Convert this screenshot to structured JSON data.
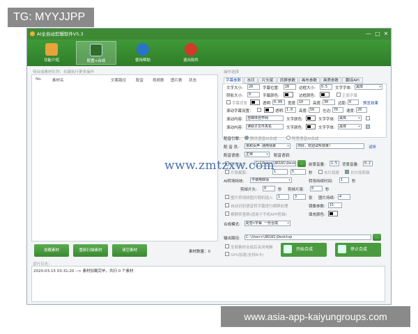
{
  "watermarks": {
    "top_left": "TG: MYYJJPP",
    "bottom_right": "www.asia-app-kaiyungroups.com",
    "center": "www.zmtzxw.com"
  },
  "app": {
    "title": "AI全自动剪辑软件V5.3",
    "window_controls": [
      "—",
      "□",
      "✕"
    ]
  },
  "toolbar": [
    {
      "label": "功能介绍",
      "icon": "home-icon"
    },
    {
      "label": "配置+合成",
      "icon": "film-icon"
    },
    {
      "label": "使用帮助",
      "icon": "help-icon"
    },
    {
      "label": "退出软件",
      "icon": "exit-icon"
    }
  ],
  "task_list": {
    "title": "待合成素材队列：右键执行更多操作",
    "columns": [
      "No.",
      "素材名",
      "文案路径",
      "配音",
      "视频数",
      "图片数",
      "状态"
    ],
    "count_label": "素材数量：0"
  },
  "buttons": {
    "load": "加载素材",
    "reload": "重新扫描素材",
    "clear": "清空素材",
    "start": "开始合成",
    "stop": "停止合成",
    "browse": "..."
  },
  "log": {
    "title": "运行日志：",
    "lines": [
      "2020-03-15 03:31:20  --> 素材加载完毕，共扫 0 个素材"
    ]
  },
  "options": {
    "title": "操作选择",
    "tabs": [
      "字幕参数",
      "水印",
      "片头尾",
      "同屏参数",
      "画布参数",
      "画质参数",
      "翻译API"
    ],
    "row1": {
      "font_size_lbl": "文字大小:",
      "font_size": "20",
      "pos_lbl": "字幕位置:",
      "pos": "20",
      "border_lbl": "边框大小:",
      "border": "0.5",
      "font_lbl": "文字字体:",
      "font": "黑体"
    },
    "row2": {
      "shadow_lbl": "阴影大小:",
      "shadow": "0",
      "color_lbl": "字幕颜色:",
      "frame_lbl": "边框颜色:",
      "follow_lbl": "正面字幕"
    },
    "row3": {
      "bg_lbl": "字幕背景",
      "alpha_lbl": "透明:",
      "alpha": "0.99",
      "w_lbl": "宽度:",
      "w": "10",
      "h_lbl": "高度:",
      "h": "30",
      "ang_lbl": "边距:",
      "ang": "0",
      "preview": "预览效果"
    },
    "row4": {
      "scroll_lbl": "滚动字幕设置：",
      "alpha": "1.0",
      "h": "50",
      "left_lbl": "左边:",
      "left": "70",
      "speed_lbl": "速度:",
      "speed": "20"
    },
    "row5": {
      "label": "滚动内容:",
      "text": "自媒体自学网",
      "font_lbl": "文字颜色:",
      "style_lbl": "文字字体:",
      "style": "黑体"
    },
    "row6": {
      "label": "滚动内容:",
      "text": "读取子文件夹名",
      "font_lbl": "文字颜色:",
      "style_lbl": "文字字体:",
      "style": "黑体"
    },
    "dub_engine": {
      "label": "配音引擎:",
      "opt1": "腾讯语音AI合成",
      "opt2": "阿里语音AI合成"
    },
    "dub_voice": {
      "label": "配 音 员:",
      "voice": "亲和女声-通用场景",
      "text": "你好，欢迎试听效果!",
      "test": "试听"
    },
    "dub_lang": {
      "label": "配音语速:",
      "rate": "正常",
      "vol_lbl": "配音语调:"
    },
    "bgm": {
      "label": "背景音乐",
      "path": "C:\\Users\\86181\\Desktop",
      "vol_lbl": "前景音量:",
      "vol": "1.5",
      "bg_lbl": "背景音量:",
      "bg": "0.2"
    },
    "silence": {
      "label": "片段截取:",
      "a": "1",
      "b": "5",
      "unit": "秒",
      "cut": "去片段尾",
      "long": "长片段剪辑"
    },
    "ai_effect": {
      "label": "AI转场特效:",
      "value": "不使用转场",
      "time_lbl": "转场持续时间:",
      "time": "1",
      "unit": "秒"
    },
    "clip_head": {
      "label": "剪掉片头:",
      "a": "0",
      "unit": "秒",
      "tail_lbl": "剪掉片尾:",
      "b": "0"
    },
    "pic_insert": {
      "label": "图片转视频图片随机插入",
      "a": "1",
      "b": "3",
      "unit": "张",
      "dur_lbl": "图片持续:",
      "dur": "4"
    },
    "subtitle_sync": {
      "label": "自动识别语音转字幕进行横屏处理",
      "mirror_lbl": "镜像参数:",
      "mirror": "15"
    },
    "vertical": {
      "label": "横屏转竖屏(适用于手机APP剪辑)",
      "fill_lbl": "填充颜色:"
    },
    "mode": {
      "label": "合成模式:",
      "value": "配音+字幕 一份合成"
    },
    "out": {
      "label": "输出路径:",
      "path": "C:\\Users\\86181\\Desktop"
    },
    "after": {
      "done": "全部素材合成后关闭电脑",
      "gpu": "GPU加速(支持N卡)"
    }
  },
  "colors": {
    "accent": "#3e8a34",
    "brand_green": "#4a9a3f"
  }
}
